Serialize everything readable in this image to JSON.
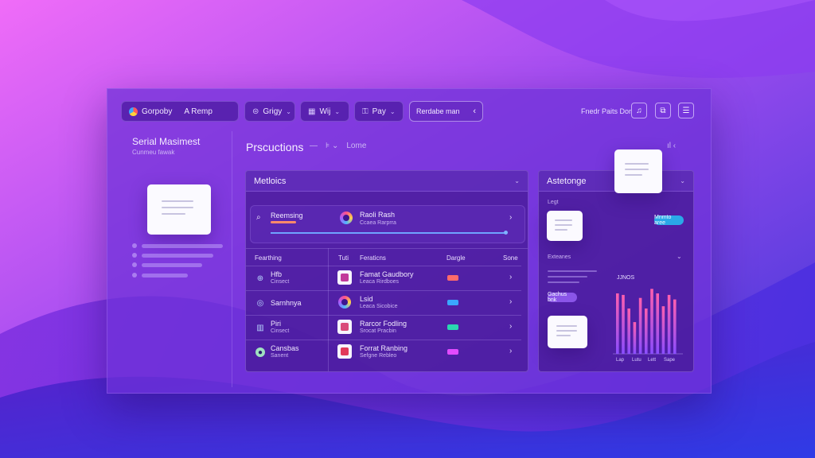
{
  "toolbar": {
    "chips": [
      {
        "label": "Gorpoby",
        "icon": "app-logo"
      },
      {
        "label": "A Remp"
      },
      {
        "label": "Grigy",
        "icon": "tag-icon"
      },
      {
        "label": "Wij",
        "icon": "grid-icon"
      },
      {
        "label": "Pay",
        "icon": "lock-icon"
      }
    ],
    "search_value": "Rerdabe man",
    "right_text": "Fnedr Paits Dor",
    "right_buttons": [
      "bell-icon",
      "share-icon",
      "menu-icon"
    ]
  },
  "sidebar": {
    "title": "Serial Masimest",
    "subtitle": "Cunmeu fawak"
  },
  "page": {
    "title": "Prscuctions",
    "tool_text": "Lome"
  },
  "panel_left": {
    "title": "Metloics",
    "highlight": {
      "left_label": "Reemsing",
      "right_label": "Raoli Rash",
      "right_sub": "Ccaea Rarprra",
      "progress": 1.0
    },
    "headers": [
      "Fearthing",
      "Tuti",
      "Feraticns",
      "Dargle",
      "Sone"
    ],
    "rows": [
      {
        "left": "Hfb",
        "left_sub": "Cinsect",
        "icon": "globe-icon",
        "title": "Famat Gaudbory",
        "sub": "Leaca Rirdboes",
        "tag_color": "#ff6a6a",
        "thumb_color": "#c23a9a"
      },
      {
        "left": "Sarnhnya",
        "left_sub": "",
        "icon": "target-icon",
        "title": "Lsid",
        "sub": "Leaca Sicobice",
        "tag_color": "#3aa7ff",
        "thumb_color": "#e8553a"
      },
      {
        "left": "Piri",
        "left_sub": "Cinsect",
        "icon": "chart-icon",
        "title": "Rarcor Fodling",
        "sub": "Srocat Pracbin",
        "tag_color": "#2ad6b0",
        "thumb_color": "#d94b7a"
      },
      {
        "left": "Cansbas",
        "left_sub": "Sanent",
        "icon": "avatar-icon",
        "title": "Forrat Ranbing",
        "sub": "Sefgne Rebleo",
        "tag_color": "#e24bff",
        "thumb_color": "#e23a5a"
      }
    ]
  },
  "panel_right": {
    "title": "Astetonge",
    "label_top": "Legt",
    "pill_top": "Mnmto aree",
    "section_label": "Exteanes",
    "pill_mid": "Gachus bnk",
    "chart_label": "JJNOS",
    "bar_colors": {
      "top": "#ff5fae",
      "bottom": "#8a4dff"
    }
  },
  "chart_data": {
    "type": "bar",
    "title": "JJNOS",
    "categories": [
      "",
      "",
      "",
      "",
      "",
      "",
      "",
      "",
      "",
      "",
      ""
    ],
    "x_ticks": [
      "Lap",
      "Lutu",
      "Lett",
      "Sape"
    ],
    "values": [
      80,
      78,
      60,
      42,
      74,
      60,
      86,
      80,
      63,
      78,
      72
    ],
    "ylim": [
      0,
      100
    ]
  }
}
